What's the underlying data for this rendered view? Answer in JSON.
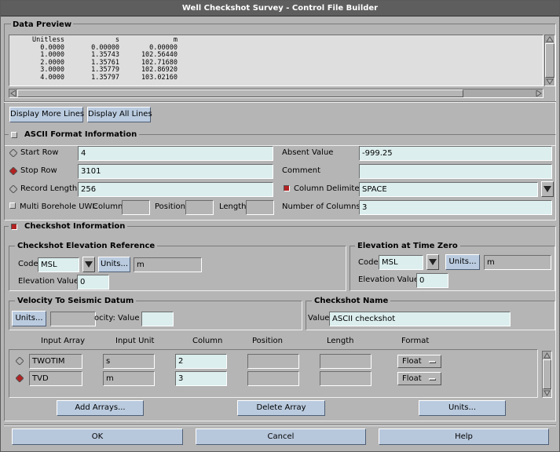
{
  "window": {
    "title": "Well Checkshot Survey - Control File Builder"
  },
  "preview": {
    "title": "Data Preview",
    "columns": [
      "Unitless",
      "s",
      "m"
    ],
    "rows": [
      [
        "0.0000",
        "0.00000",
        "0.00000"
      ],
      [
        "1.0000",
        "1.35743",
        "102.56440"
      ],
      [
        "2.0000",
        "1.35761",
        "102.71680"
      ],
      [
        "3.0000",
        "1.35779",
        "102.86920"
      ],
      [
        "4.0000",
        "1.35797",
        "103.02160"
      ]
    ],
    "more_label": "Display More Lines",
    "all_label": "Display All Lines"
  },
  "ascii": {
    "title": "ASCII Format Information",
    "start_row_label": "Start Row",
    "start_row": "4",
    "stop_row_label": "Stop Row",
    "stop_row": "3101",
    "record_length_label": "Record Length",
    "record_length": "256",
    "multi_label": "Multi Borehole UWI:",
    "column_label": "Column",
    "position_label": "Position",
    "length_label": "Length",
    "absent_label": "Absent Value",
    "absent": "-999.25",
    "comment_label": "Comment",
    "comment": "",
    "delimiter_label": "Column Delimiter",
    "delimiter": "SPACE",
    "ncols_label": "Number of Columns",
    "ncols": "3"
  },
  "checkshot": {
    "title": "Checkshot Information",
    "elev_ref": {
      "title": "Checkshot Elevation Reference",
      "code_label": "Code:",
      "code": "MSL",
      "units_label": "Units...",
      "units": "m",
      "value_label": "Elevation  Value",
      "value": "0"
    },
    "elev_zero": {
      "title": "Elevation at Time Zero",
      "code_label": "Code",
      "code": "MSL",
      "units_label": "Units...",
      "units": "m",
      "value_label": "Elevation  Value",
      "value": "0"
    },
    "velocity": {
      "title": "Velocity To Seismic Datum",
      "units_label": "Units...",
      "value_label": "ocity:  Value",
      "value": ""
    },
    "name": {
      "title": "Checkshot Name",
      "value_label": "Value",
      "value": "ASCII checkshot"
    }
  },
  "arrays": {
    "headers": [
      "Input Array",
      "Input Unit",
      "Column",
      "Position",
      "Length",
      "Format"
    ],
    "rows": [
      {
        "name": "TWOTIM",
        "unit": "s",
        "column": "2",
        "format": "Float"
      },
      {
        "name": "TVD",
        "unit": "m",
        "column": "3",
        "format": "Float"
      }
    ],
    "add_label": "Add Arrays...",
    "delete_label": "Delete Array",
    "units_label": "Units..."
  },
  "footer": {
    "ok": "OK",
    "cancel": "Cancel",
    "help": "Help"
  },
  "colors": {
    "field": "#dceeee",
    "button": "#bacbdf",
    "background": "#b5b5b5",
    "marker": "#b22222"
  }
}
